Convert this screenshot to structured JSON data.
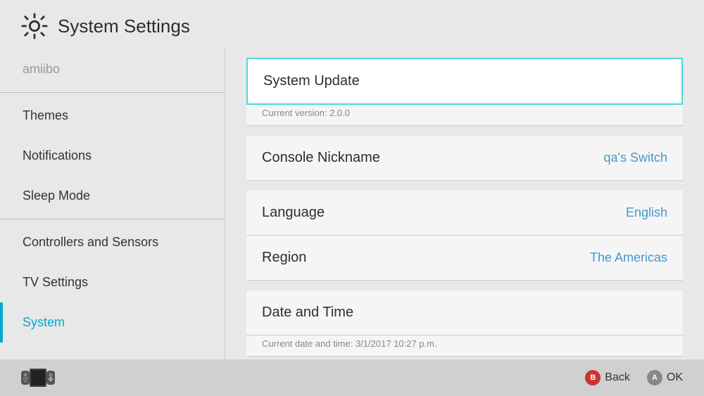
{
  "header": {
    "title": "System Settings",
    "icon_label": "settings-gear-icon"
  },
  "sidebar": {
    "items": [
      {
        "id": "amiibo",
        "label": "amiibo",
        "active": false,
        "dimmed": true
      },
      {
        "id": "themes",
        "label": "Themes",
        "active": false,
        "dimmed": false
      },
      {
        "id": "notifications",
        "label": "Notifications",
        "active": false,
        "dimmed": false
      },
      {
        "id": "sleep-mode",
        "label": "Sleep Mode",
        "active": false,
        "dimmed": false
      },
      {
        "id": "controllers",
        "label": "Controllers and Sensors",
        "active": false,
        "dimmed": false
      },
      {
        "id": "tv-settings",
        "label": "TV Settings",
        "active": false,
        "dimmed": false
      },
      {
        "id": "system",
        "label": "System",
        "active": true,
        "dimmed": false
      }
    ]
  },
  "panel": {
    "items": [
      {
        "id": "system-update",
        "label": "System Update",
        "value": "",
        "sub": "Current version: 2.0.0",
        "highlighted": true
      },
      {
        "id": "console-nickname",
        "label": "Console Nickname",
        "value": "qa's Switch",
        "sub": "",
        "highlighted": false
      },
      {
        "id": "language",
        "label": "Language",
        "value": "English",
        "sub": "",
        "highlighted": false
      },
      {
        "id": "region",
        "label": "Region",
        "value": "The Americas",
        "sub": "",
        "highlighted": false
      },
      {
        "id": "date-and-time",
        "label": "Date and Time",
        "value": "",
        "sub": "Current date and time: 3/1/2017 10:27 p.m.",
        "highlighted": false
      }
    ]
  },
  "footer": {
    "back_label": "Back",
    "ok_label": "OK",
    "b_button": "B",
    "a_button": "A"
  }
}
